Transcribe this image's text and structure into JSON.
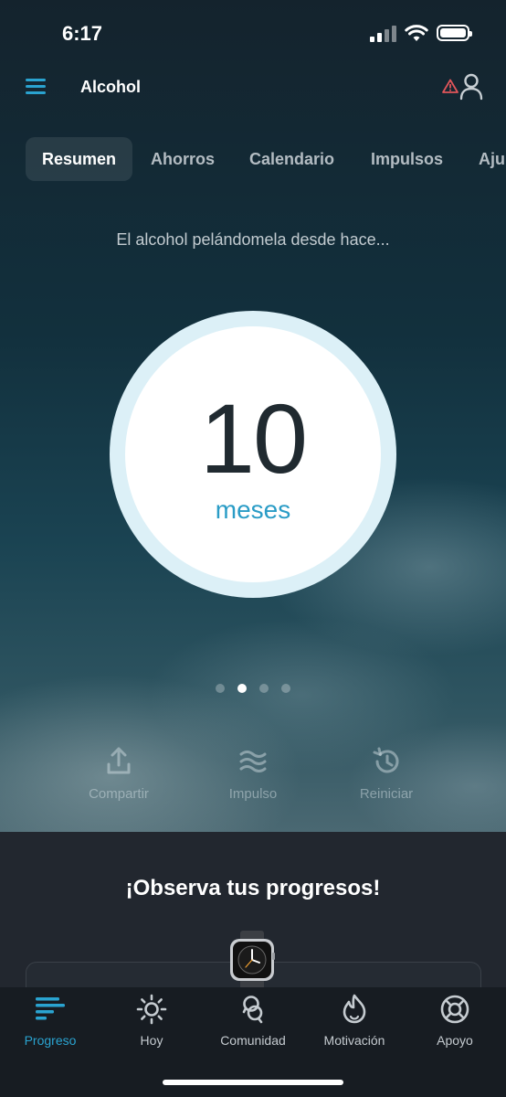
{
  "status_bar": {
    "time": "6:17"
  },
  "header": {
    "title": "Alcohol"
  },
  "tabs": [
    {
      "label": "Resumen",
      "active": true
    },
    {
      "label": "Ahorros"
    },
    {
      "label": "Calendario"
    },
    {
      "label": "Impulsos"
    },
    {
      "label": "Aju"
    }
  ],
  "summary": {
    "subtitle": "El alcohol pelándomela desde hace...",
    "value": "10",
    "unit": "meses"
  },
  "pager": {
    "count": 4,
    "active_index": 1
  },
  "actions": [
    {
      "label": "Compartir",
      "icon": "share-icon"
    },
    {
      "label": "Impulso",
      "icon": "waves-icon"
    },
    {
      "label": "Reiniciar",
      "icon": "history-icon"
    }
  ],
  "progress_panel": {
    "title": "¡Observa tus progresos!"
  },
  "tab_bar": [
    {
      "label": "Progreso",
      "icon": "progress-icon",
      "active": true
    },
    {
      "label": "Hoy",
      "icon": "sun-icon"
    },
    {
      "label": "Comunidad",
      "icon": "community-icon"
    },
    {
      "label": "Motivación",
      "icon": "motivation-icon"
    },
    {
      "label": "Apoyo",
      "icon": "lifebuoy-icon"
    }
  ],
  "colors": {
    "accent": "#2aa3d0",
    "warning": "#e0555a",
    "panel": "#22272f",
    "tabbar": "#171c22"
  }
}
